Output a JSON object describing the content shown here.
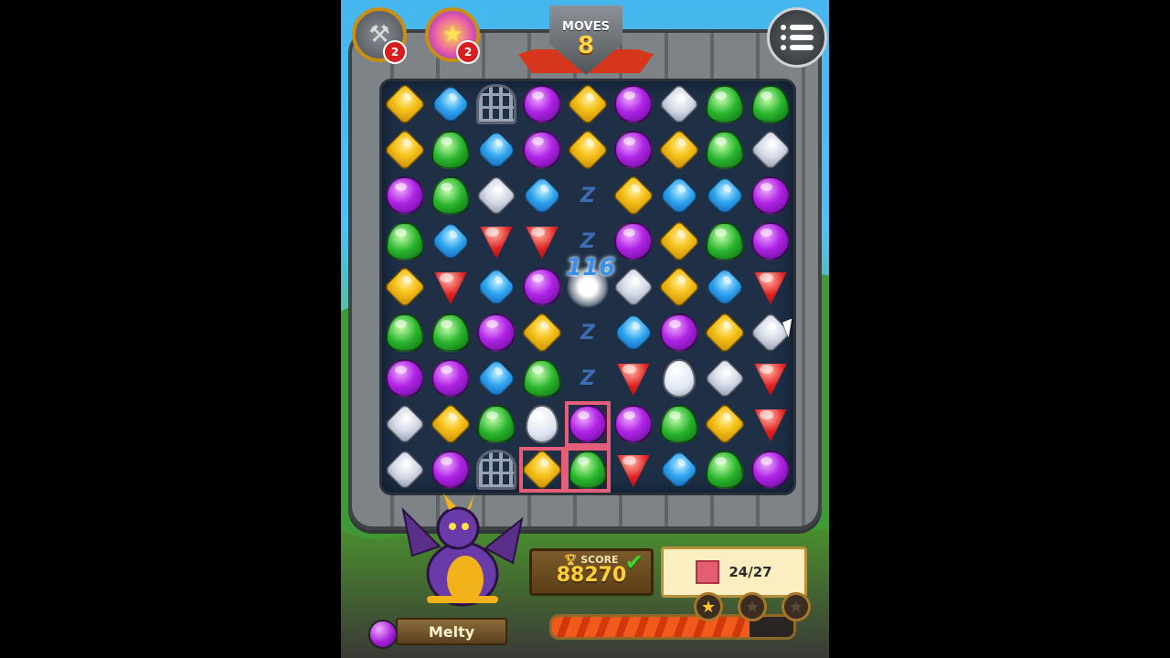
{
  "moves": {
    "label": "MOVES",
    "value": "8"
  },
  "boosters": [
    {
      "icon": "hammer-icon",
      "count": "2"
    },
    {
      "icon": "star-bomb-icon",
      "count": "2"
    }
  ],
  "menu": {
    "icon": "menu-icon"
  },
  "board": {
    "rows": [
      [
        "yellow",
        "blue",
        "cage",
        "purple",
        "yellow",
        "purple",
        "white",
        "green",
        "green"
      ],
      [
        "yellow",
        "green",
        "blue",
        "purple",
        "yellow",
        "purple",
        "yellow",
        "green",
        "white"
      ],
      [
        "purple",
        "green",
        "white",
        "blue",
        "bolt",
        "yellow",
        "blue",
        "blue",
        "purple"
      ],
      [
        "green",
        "blue",
        "red",
        "red",
        "bolt",
        "purple",
        "yellow",
        "green",
        "purple"
      ],
      [
        "yellow",
        "red",
        "blue",
        "purple",
        "flash",
        "white",
        "yellow",
        "blue",
        "red"
      ],
      [
        "green",
        "green",
        "purple",
        "yellow",
        "bolt",
        "blue",
        "purple",
        "yellow",
        "white"
      ],
      [
        "purple",
        "purple",
        "blue",
        "green",
        "bolt",
        "red",
        "egg",
        "white",
        "red"
      ],
      [
        "white",
        "yellow",
        "green",
        "egg",
        "purple-tile",
        "purple",
        "green",
        "yellow",
        "red"
      ],
      [
        "white",
        "purple",
        "cage-purple",
        "yellow-tile",
        "green-tile",
        "red",
        "blue",
        "green",
        "purple"
      ]
    ],
    "floating_score": "116"
  },
  "score": {
    "label": "SCORE",
    "value": "88270"
  },
  "goal": {
    "icon": "red-tile-icon",
    "progress_text": "24/27"
  },
  "progress": {
    "fraction": 0.82,
    "stars_lit": 1,
    "stars_total": 3
  },
  "hero": {
    "name": "Melty",
    "gem_color": "#a61edc"
  },
  "colors": {
    "sky": "#4fc0f2",
    "board": "#1e2f46",
    "score_text": "#ffcf3a",
    "progress_fill": "#f15a1a"
  }
}
